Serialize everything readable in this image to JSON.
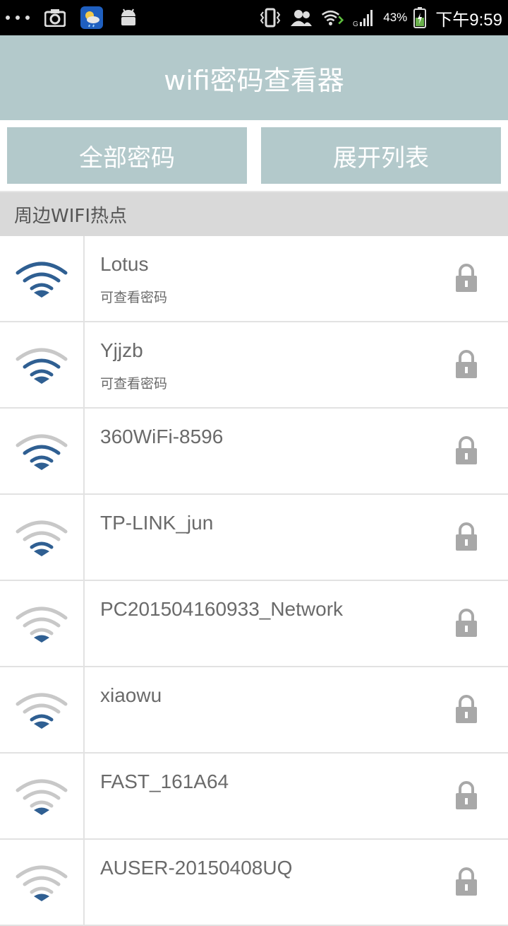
{
  "status_bar": {
    "battery": "43%",
    "time": "下午9:59"
  },
  "header": {
    "title": "wifi密码查看器"
  },
  "buttons": {
    "all_passwords": "全部密码",
    "expand_list": "展开列表"
  },
  "section": {
    "title": "周边WIFI热点"
  },
  "colors": {
    "accent": "#b3c9cb",
    "wifi_active": "#2f5f92",
    "wifi_inactive": "#c8c8c8",
    "lock": "#a8a8a8"
  },
  "networks": [
    {
      "ssid": "Lotus",
      "subtitle": "可查看密码",
      "bars": 3
    },
    {
      "ssid": "Yjjzb",
      "subtitle": "可查看密码",
      "bars": 2
    },
    {
      "ssid": "360WiFi-8596",
      "subtitle": "",
      "bars": 2
    },
    {
      "ssid": "TP-LINK_jun",
      "subtitle": "",
      "bars": 1
    },
    {
      "ssid": "PC201504160933_Network",
      "subtitle": "",
      "bars": 0
    },
    {
      "ssid": "xiaowu",
      "subtitle": "",
      "bars": 1
    },
    {
      "ssid": "FAST_161A64",
      "subtitle": "",
      "bars": 0
    },
    {
      "ssid": "AUSER-20150408UQ",
      "subtitle": "",
      "bars": 0
    }
  ]
}
